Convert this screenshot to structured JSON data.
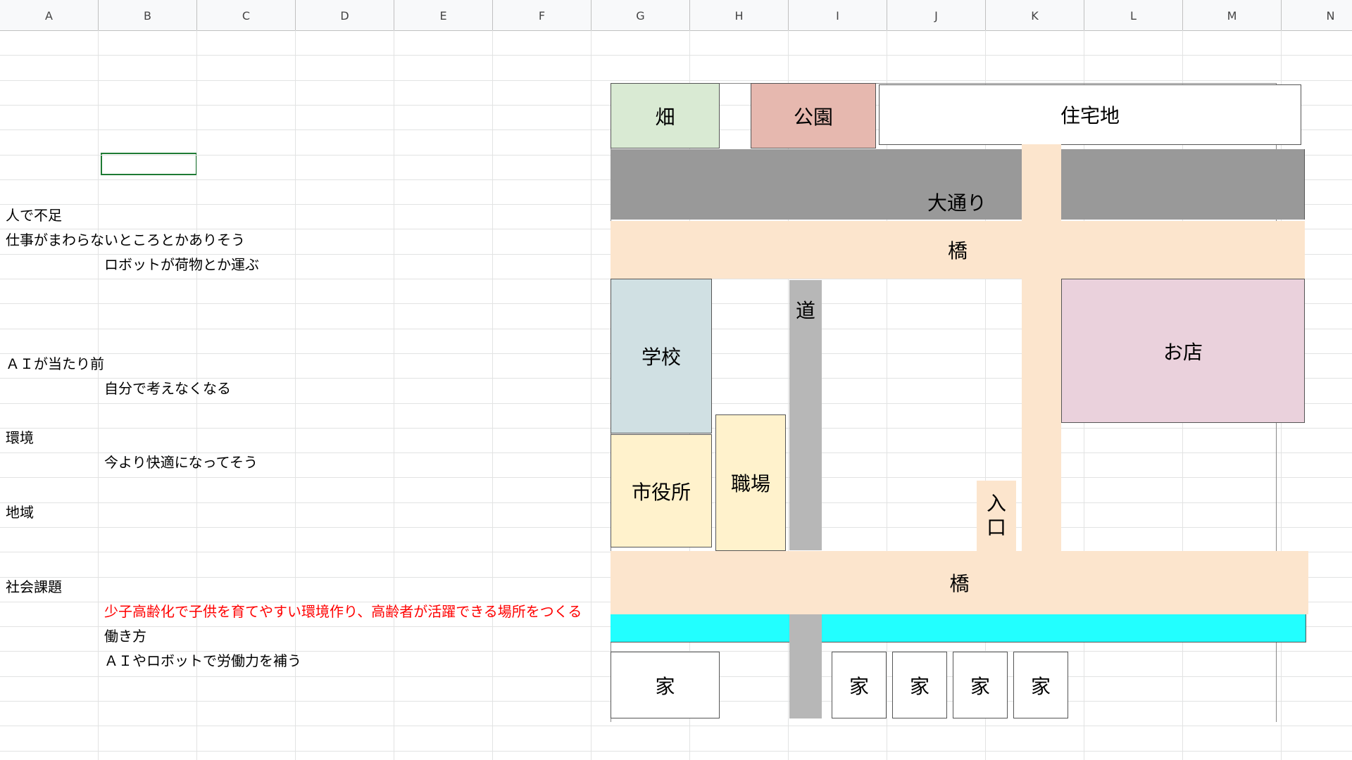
{
  "columns": [
    "A",
    "B",
    "C",
    "D",
    "E",
    "F",
    "G",
    "H",
    "I",
    "J",
    "K",
    "L",
    "M",
    "N"
  ],
  "cells": [
    {
      "id": "a8",
      "text": "人で不足",
      "red": false
    },
    {
      "id": "a9",
      "text": "仕事がまわらないところとかありそう",
      "red": false
    },
    {
      "id": "b10",
      "text": "ロボットが荷物とか運ぶ",
      "red": false
    },
    {
      "id": "a14",
      "text": "ＡＩが当たり前",
      "red": false
    },
    {
      "id": "b15",
      "text": "自分で考えなくなる",
      "red": false
    },
    {
      "id": "a17",
      "text": "環境",
      "red": false
    },
    {
      "id": "b18",
      "text": "今より快適になってそう",
      "red": false
    },
    {
      "id": "a20",
      "text": "地域",
      "red": false
    },
    {
      "id": "a23",
      "text": "社会課題",
      "red": false
    },
    {
      "id": "b24",
      "text": "少子高齢化で子供を育てやすい環境作り、高齢者が活躍できる場所をつくる",
      "red": true
    },
    {
      "id": "b25",
      "text": "働き方",
      "red": false
    },
    {
      "id": "b26",
      "text": "ＡＩやロボットで労働力を補う",
      "red": false
    }
  ],
  "map": {
    "hatake": "畑",
    "koen": "公園",
    "jutakuchi": "住宅地",
    "odori": "大通り",
    "hashi_top": "橋",
    "michi": "道",
    "gakko": "学校",
    "omise": "お店",
    "shokuba": "職場",
    "shiyakusho": "市役所",
    "iriguchi": [
      "入",
      "口"
    ],
    "hashi_bottom": "橋",
    "houses": [
      "家",
      "家",
      "家",
      "家",
      "家"
    ]
  },
  "colors": {
    "hatake": "#d9ead3",
    "koen": "#e6b8af",
    "road_gray": "#999999",
    "bridge": "#fce5cd",
    "michi": "#b7b7b7",
    "gakko": "#d0e0e3",
    "omise": "#ead1dc",
    "yellow": "#fff2cc",
    "river": "#22ffff",
    "selection": "#1e7b34"
  }
}
